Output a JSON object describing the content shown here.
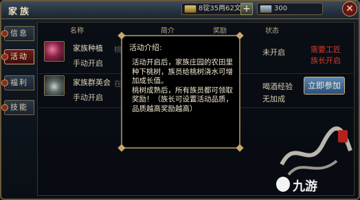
{
  "header": {
    "title": "家族",
    "gold": "8锭35两62文",
    "gem": "300",
    "plus_label": "+",
    "close_label": "✕"
  },
  "tabs": [
    {
      "label": "信息"
    },
    {
      "label": "活动"
    },
    {
      "label": "福利"
    },
    {
      "label": "技能"
    }
  ],
  "table": {
    "headers": [
      "名称",
      "简介",
      "奖励",
      "状态"
    ],
    "rows": [
      {
        "name": "家族种植",
        "mode": "手动开启",
        "intro": "桃树",
        "status": "未开启",
        "requirements": [
          "需要工匠",
          "族长开启"
        ]
      },
      {
        "name": "家族群英会",
        "mode": "手动开启",
        "intro": "在群",
        "status": "喝酒经验",
        "status2": "无加成",
        "action": "立即参加"
      }
    ]
  },
  "popup": {
    "title": "活动介绍:",
    "paragraphs": [
      "活动开启后，家族庄园的农田里种下桃树，族员给桃树浇水可增加成长值。",
      "桃树成熟后，所有族员都可领取奖励！（族长可设置活动品质，品质越高奖励越高）"
    ]
  },
  "watermark": {
    "brand": "九游"
  },
  "colors": {
    "accent_gold": "#c6a868",
    "alert_red": "#d43a2a",
    "button_blue": "#3b6a99"
  }
}
